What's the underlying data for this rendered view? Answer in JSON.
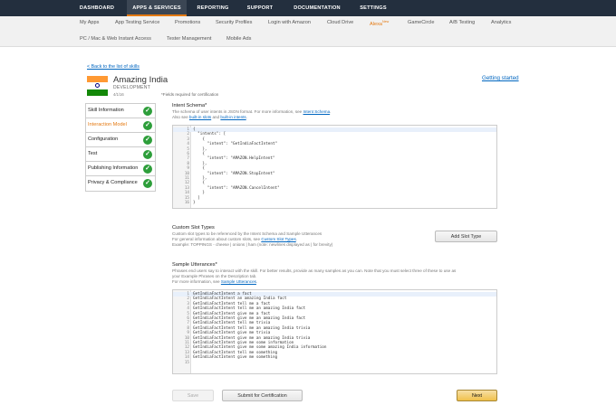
{
  "topnav": [
    "DASHBOARD",
    "APPS & SERVICES",
    "REPORTING",
    "SUPPORT",
    "DOCUMENTATION",
    "SETTINGS"
  ],
  "subnav_row1": [
    "My Apps",
    "App Testing Service",
    "Promotions",
    "Security Profiles",
    "Login with Amazon",
    "Cloud Drive",
    "Alexa",
    "GameCircle",
    "A/B Testing",
    "Analytics"
  ],
  "alexa_badge": "New",
  "subnav_row2": [
    "PC / Mac & Web Instant Access",
    "Tester Management",
    "Mobile Ads"
  ],
  "back_link": "< Back to the list of skills",
  "getting_started": "Getting started",
  "skill": {
    "name": "Amazing India",
    "status": "DEVELOPMENT",
    "date": "4/1/16"
  },
  "required_note": "*Fields required for certification",
  "flag_colors": [
    "#ff9933",
    "#ffffff",
    "#138808"
  ],
  "steps": [
    {
      "label": "Skill Information",
      "active": false
    },
    {
      "label": "Interaction Model",
      "active": true
    },
    {
      "label": "Configuration",
      "active": false
    },
    {
      "label": "Test",
      "active": false
    },
    {
      "label": "Publishing Information",
      "active": false
    },
    {
      "label": "Privacy & Compliance",
      "active": false
    }
  ],
  "intent_schema": {
    "title": "Intent Schema",
    "desc1_pre": "The schema of user intents in JSON format. For more information, see ",
    "desc1_link": "Intent Schema",
    "desc2_pre": "Also see ",
    "desc2_link1": "built-in slots",
    "desc2_mid": " and ",
    "desc2_link2": "built-in intents",
    "lines": [
      "{",
      "  \"intents\": [",
      "    {",
      "      \"intent\": \"GetIndiaFactIntent\"",
      "    },",
      "    {",
      "      \"intent\": \"AMAZON.HelpIntent\"",
      "    },",
      "    {",
      "      \"intent\": \"AMAZON.StopIntent\"",
      "    },",
      "    {",
      "      \"intent\": \"AMAZON.CancelIntent\"",
      "    }",
      "  ]",
      "}"
    ]
  },
  "custom_slots": {
    "title": "Custom Slot Types",
    "desc1": "Custom slot types to be referenced by the Intent Schema and Sample Utterances",
    "desc2_pre": "For general information about custom slots, see ",
    "desc2_link": "Custom Slot Types",
    "desc3": "Example: TOPPINGS - cheese | onions | ham (note: newlines displayed as | for brevity)",
    "button": "Add Slot Type"
  },
  "utterances": {
    "title": "Sample Utterances",
    "desc1": "Phrases end users say to interact with the skill. For better results, provide as many samples as you can. Note that you must select three of these to use as",
    "desc2": "your Example Phrases on the Description tab.",
    "desc3_pre": "For more information, see ",
    "desc3_link": "Sample Utterances",
    "lines": [
      "GetIndiaFactIntent a fact",
      "GetIndiaFactIntent an amazing India fact",
      "GetIndiaFactIntent tell me a fact",
      "GetIndiaFactIntent tell me an amazing India fact",
      "GetIndiaFactIntent give me a fact",
      "GetIndiaFactIntent give me an amazing India fact",
      "GetIndiaFactIntent tell me trivia",
      "GetIndiaFactIntent tell me an amazing India trivia",
      "GetIndiaFactIntent give me trivia",
      "GetIndiaFactIntent give me an amazing India trivia",
      "GetIndiaFactIntent give me some information",
      "GetIndiaFactIntent give me some amazing India information",
      "GetIndiaFactIntent tell me something",
      "GetIndiaFactIntent give me something",
      ""
    ]
  },
  "buttons": {
    "save": "Save",
    "submit": "Submit for Certification",
    "next": "Next"
  }
}
